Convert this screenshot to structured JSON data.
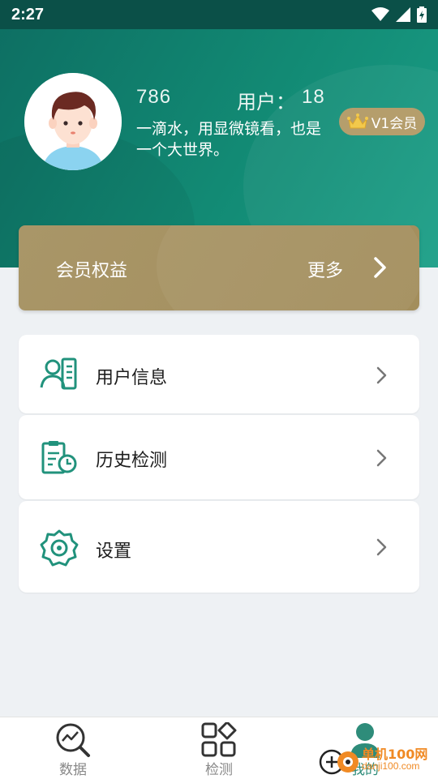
{
  "status_bar": {
    "time": "2:27"
  },
  "profile": {
    "id": "786",
    "user_label": "用户：",
    "phone": "18",
    "motto": "一滴水，用显微镜看，也是一个大世界。",
    "vip_label": "V1会员"
  },
  "benefits": {
    "title": "会员权益",
    "more": "更多"
  },
  "menu": {
    "items": [
      {
        "label": "用户信息",
        "icon": "user-info-icon"
      },
      {
        "label": "历史检测",
        "icon": "history-icon"
      },
      {
        "label": "设置",
        "icon": "settings-icon"
      }
    ]
  },
  "bottom_nav": {
    "items": [
      {
        "label": "数据",
        "icon": "chart-icon"
      },
      {
        "label": "检测",
        "icon": "grid-icon"
      },
      {
        "label": "我的",
        "icon": "person-icon",
        "active": true
      }
    ]
  },
  "watermark": {
    "text": "单机100网",
    "sub": "danji100.com"
  },
  "colors": {
    "primary": "#128a74",
    "header_dark": "#0d6e62",
    "gold": "#a99668",
    "background": "#eef1f4"
  }
}
